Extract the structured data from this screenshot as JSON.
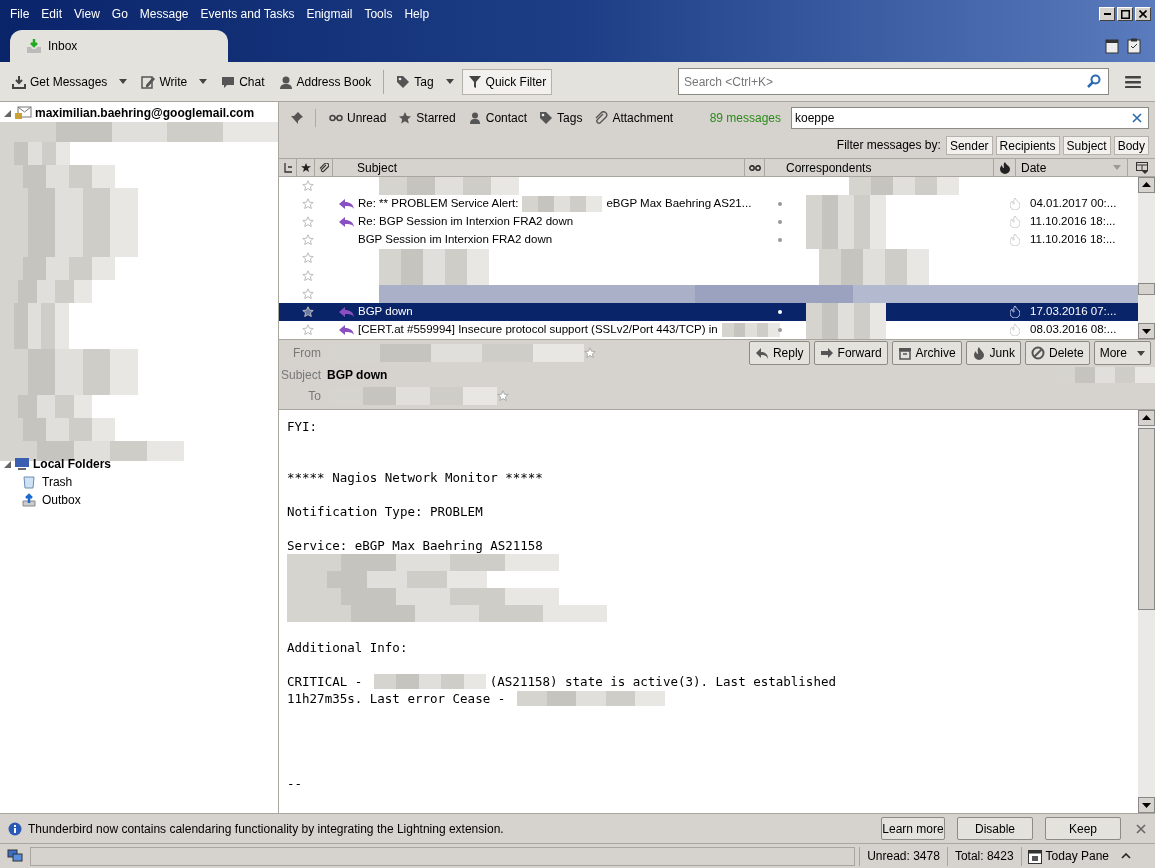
{
  "menu": [
    "File",
    "Edit",
    "View",
    "Go",
    "Message",
    "Events and Tasks",
    "Enigmail",
    "Tools",
    "Help"
  ],
  "tabs": [
    {
      "label": "Inbox",
      "selected": true
    }
  ],
  "toolbar": {
    "buttons": [
      {
        "label": "Get Messages",
        "kind": "get",
        "dropdown": true,
        "checked": false
      },
      {
        "label": "Write",
        "kind": "write",
        "dropdown": true,
        "checked": false
      },
      {
        "label": "Chat",
        "kind": "chat",
        "dropdown": false,
        "checked": false
      },
      {
        "label": "Address Book",
        "kind": "addressbook",
        "dropdown": false,
        "checked": false
      },
      {
        "label": "Tag",
        "kind": "tag",
        "dropdown": true,
        "checked": false
      },
      {
        "label": "Quick Filter",
        "kind": "filter",
        "dropdown": false,
        "checked": true
      }
    ],
    "search": {
      "placeholder": "Search <Ctrl+K>"
    }
  },
  "folders": [
    {
      "label": "maximilian.baehring@googlemail.com",
      "kind": "account",
      "expanded": true,
      "children": [
        {
          "kind": "redacted"
        }
      ]
    },
    {
      "label": "Local Folders",
      "kind": "local",
      "expanded": true,
      "children": [
        {
          "label": "Trash",
          "kind": "trash"
        },
        {
          "label": "Outbox",
          "kind": "outbox"
        }
      ]
    }
  ],
  "quick_filter": {
    "toggles": [
      {
        "label": "Unread",
        "kind": "unread",
        "checked": false
      },
      {
        "label": "Starred",
        "kind": "starred",
        "checked": false
      },
      {
        "label": "Contact",
        "kind": "contact",
        "checked": false
      },
      {
        "label": "Tags",
        "kind": "tags",
        "checked": false
      },
      {
        "label": "Attachment",
        "kind": "attachment",
        "checked": false
      }
    ],
    "count": "89 messages",
    "value": "koeppe",
    "filter_label": "Filter messages by:",
    "filter_by": [
      {
        "label": "Sender",
        "selected": true
      },
      {
        "label": "Recipients",
        "selected": true
      },
      {
        "label": "Subject",
        "selected": true
      },
      {
        "label": "Body",
        "selected": true
      }
    ]
  },
  "table": {
    "columns": [
      "Subject",
      "Correspondents",
      "Date"
    ],
    "rows": [
      {
        "kind": "redacted",
        "starred": false,
        "selected": false
      },
      {
        "kind": "message",
        "subject": "Re: ** PROBLEM Service Alert:",
        "subject_tail": "eBGP Max Baehring AS21...",
        "replied": true,
        "starred": false,
        "selected": false,
        "date": "04.01.2017 00:..."
      },
      {
        "kind": "message",
        "subject": "Re: BGP Session im Interxion FRA2 down",
        "replied": true,
        "starred": false,
        "selected": false,
        "date": "11.10.2016 18:..."
      },
      {
        "kind": "message",
        "subject": "BGP Session im Interxion FRA2 down",
        "replied": false,
        "starred": false,
        "selected": false,
        "date": "11.10.2016 18:..."
      },
      {
        "kind": "redacted",
        "starred": false,
        "selected": false
      },
      {
        "kind": "redacted",
        "starred": false,
        "selected": false
      },
      {
        "kind": "redacted",
        "starred": false,
        "selected": false
      },
      {
        "kind": "message",
        "subject": "BGP down",
        "replied": true,
        "starred": false,
        "selected": true,
        "date": "17.03.2016 07:..."
      },
      {
        "kind": "message",
        "subject": "[CERT.at #559994] Insecure protocol support (SSLv2/Port 443/TCP) in",
        "replied": true,
        "starred": false,
        "selected": false,
        "date": "08.03.2016 08:..."
      }
    ]
  },
  "header": {
    "from_label": "From",
    "subject_label": "Subject",
    "subject": "BGP down",
    "to_label": "To",
    "buttons": [
      {
        "label": "Reply",
        "kind": "reply"
      },
      {
        "label": "Forward",
        "kind": "forward"
      },
      {
        "label": "Archive",
        "kind": "archive"
      },
      {
        "label": "Junk",
        "kind": "junk"
      },
      {
        "label": "Delete",
        "kind": "delete"
      },
      {
        "label": "More",
        "kind": "more"
      }
    ]
  },
  "body": [
    {
      "kind": "text",
      "segments": [
        {
          "text": "FYI:"
        }
      ]
    },
    {
      "kind": "blank"
    },
    {
      "kind": "blank"
    },
    {
      "kind": "text",
      "segments": [
        {
          "text": "***** Nagios Network Monitor *****"
        }
      ]
    },
    {
      "kind": "blank"
    },
    {
      "kind": "text",
      "segments": [
        {
          "text": "Notification Type: PROBLEM"
        }
      ]
    },
    {
      "kind": "blank"
    },
    {
      "kind": "text",
      "segments": [
        {
          "text": "Service: eBGP Max Baehring AS21158"
        }
      ]
    },
    {
      "kind": "redacted"
    },
    {
      "kind": "redacted"
    },
    {
      "kind": "redacted"
    },
    {
      "kind": "redacted"
    },
    {
      "kind": "blank"
    },
    {
      "kind": "text",
      "segments": [
        {
          "text": "Additional Info:"
        }
      ]
    },
    {
      "kind": "blank"
    },
    {
      "kind": "text",
      "segments": [
        {
          "text": "CRITICAL - "
        },
        {
          "kind": "redacted"
        },
        {
          "text": "(AS21158) state is active(3). Last established"
        }
      ]
    },
    {
      "kind": "text",
      "segments": [
        {
          "text": "11h27m35s. Last error Cease - "
        },
        {
          "kind": "redacted"
        }
      ]
    },
    {
      "kind": "blank"
    },
    {
      "kind": "blank"
    },
    {
      "kind": "blank"
    },
    {
      "kind": "blank"
    },
    {
      "kind": "text",
      "segments": [
        {
          "text": "--"
        }
      ]
    }
  ],
  "notification": {
    "text": "Thunderbird now contains calendaring functionality by integrating the Lightning extension.",
    "buttons": [
      "Learn more",
      "Disable",
      "Keep"
    ]
  },
  "status_bar": {
    "unread": "Unread: 3478",
    "total": "Total: 8423",
    "today_pane": "Today Pane"
  }
}
